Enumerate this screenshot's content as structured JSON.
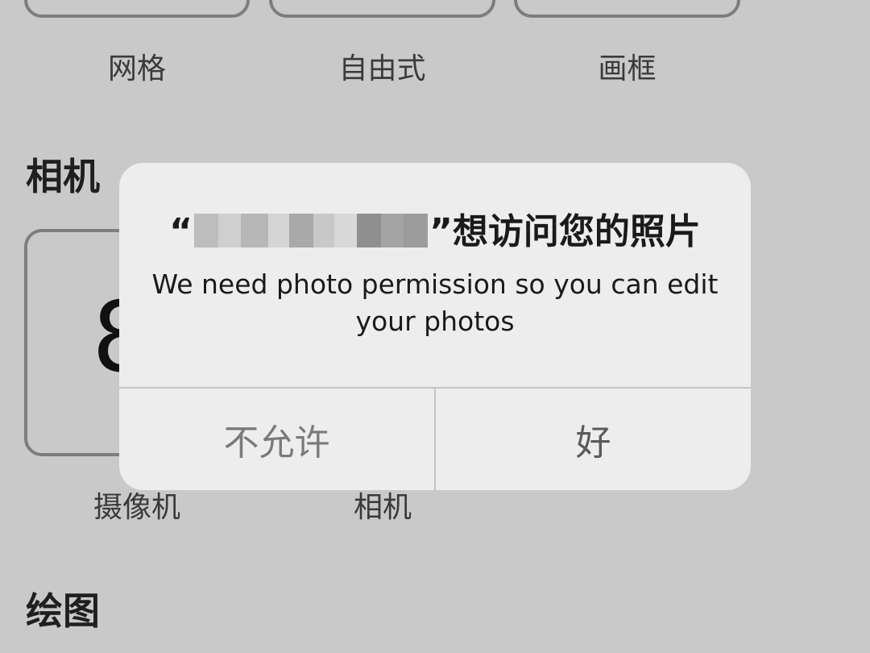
{
  "background": {
    "layout_labels": [
      "网格",
      "自由式",
      "画框"
    ],
    "section_camera": "相机",
    "camera_glyph": "8",
    "camera_labels": [
      "摄像机",
      "相机"
    ],
    "section_draw": "绘图"
  },
  "alert": {
    "title_open_quote": "“",
    "title_close_quote": "”",
    "title_suffix": "想访问您的照片",
    "message": "We need photo permission so you can edit your photos",
    "deny_label": "不允许",
    "ok_label": "好"
  },
  "colors": {
    "backdrop": "#c9c9c9",
    "alert_bg": "#ededed",
    "divider": "#c4c4c4",
    "deny_text": "#7a7a7a",
    "ok_text": "#5a5a5a"
  }
}
